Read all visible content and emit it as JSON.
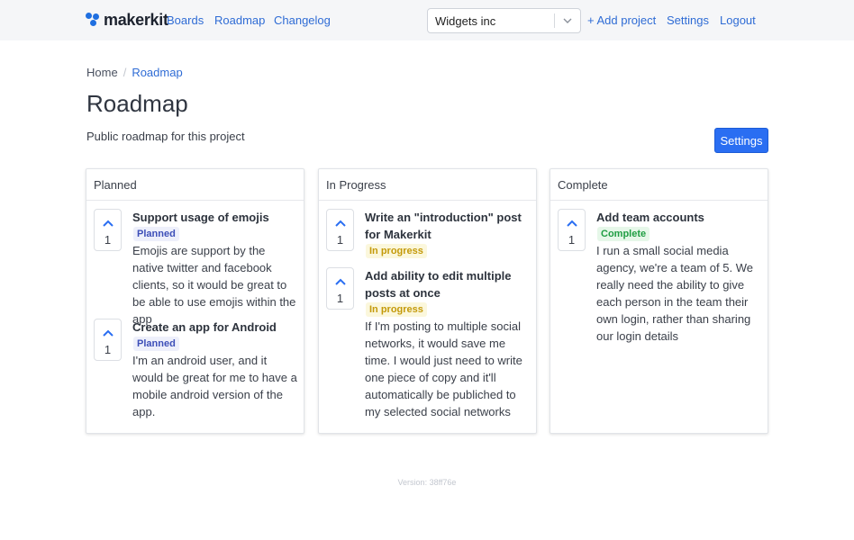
{
  "brand": {
    "name": "makerkit",
    "accent": "#1f6fe0"
  },
  "nav": {
    "links": [
      "Boards",
      "Roadmap",
      "Changelog"
    ],
    "project_select": {
      "value": "Widgets inc",
      "icon": "chevron-down-icon"
    },
    "add_project": "+ Add project",
    "settings": "Settings",
    "logout": "Logout"
  },
  "breadcrumb": {
    "home": "Home",
    "separator": "/",
    "current": "Roadmap"
  },
  "page": {
    "title": "Roadmap",
    "subtitle": "Public roadmap for this project",
    "settings_button": "Settings"
  },
  "columns": [
    {
      "title": "Planned",
      "items": [
        {
          "title": "Support usage of emojis",
          "badge": "Planned",
          "votes": "1",
          "description": "Emojis are support by the native twitter and facebook clients, so it would be great to be able to use emojis within the app"
        },
        {
          "title": "Create an app for Android",
          "badge": "Planned",
          "votes": "1",
          "description": "I'm an android user, and it would be great for me to have a mobile android version of the app."
        }
      ]
    },
    {
      "title": "In Progress",
      "items": [
        {
          "title": "Write an \"introduction\" post for Makerkit",
          "badge": "In progress",
          "votes": "1",
          "description": ""
        },
        {
          "title": "Add ability to edit multiple posts at once",
          "badge": "In progress",
          "votes": "1",
          "description": "If I'm posting to multiple social networks, it would save me time. I would just need to write one piece of copy and it'll automatically be publiched to my selected social networks"
        }
      ]
    },
    {
      "title": "Complete",
      "items": [
        {
          "title": "Add team accounts",
          "badge": "Complete",
          "votes": "1",
          "description": "I run a small social media agency, we're a team of 5. We really need the ability to give each person in the team their own login, rather than sharing our login details"
        }
      ]
    }
  ],
  "footer": {
    "version": "Version: 38ff76e"
  }
}
